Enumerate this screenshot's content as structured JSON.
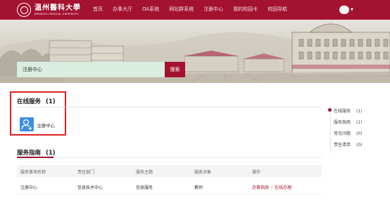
{
  "header": {
    "logo_cn": "温州醫科大學",
    "logo_en": "WENZHOU MEDICAL UNIVERSITY",
    "nav": [
      "首页",
      "办事大厅",
      "OA系统",
      "网站群系统",
      "注册中心",
      "我的校园卡",
      "校园导航"
    ],
    "user_menu_icon": "chevron-down-icon"
  },
  "search": {
    "value": "注册中心",
    "button_label": "搜索"
  },
  "online_services": {
    "title": "在线服务",
    "count": "(1)",
    "items": [
      {
        "label": "注册中心",
        "icon": "user-add-icon"
      }
    ]
  },
  "service_guide": {
    "title": "服务指南",
    "count": "(1)",
    "columns": [
      "服务事项名称",
      "责任部门",
      "服务主题",
      "服务对象",
      "操作"
    ],
    "rows": [
      {
        "name": "注册中心",
        "department": "信息技术中心",
        "topic": "信息服务",
        "audience": "教师",
        "action_guide": "办事指南",
        "action_sep": "|",
        "action_online": "在线办理"
      }
    ]
  },
  "side_nav": {
    "items": [
      {
        "label": "在线服务",
        "count": "(1)"
      },
      {
        "label": "服务指南",
        "count": "(1)"
      },
      {
        "label": "常见问题",
        "count": "(0)"
      },
      {
        "label": "责任清单",
        "count": "(0)"
      }
    ]
  },
  "colors": {
    "brand": "#a3122f",
    "highlight_border": "#e02020",
    "service_icon": "#3c8ee8",
    "search_bg": "#d9ede0"
  }
}
